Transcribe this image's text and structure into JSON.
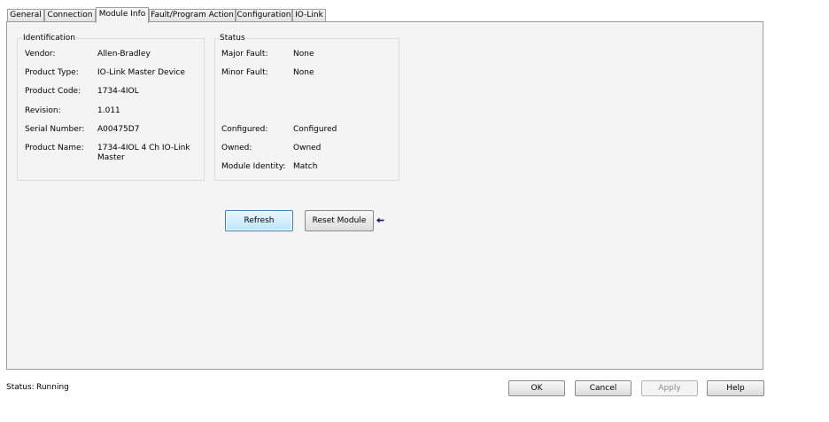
{
  "tabs": {
    "general": "General",
    "connection": "Connection",
    "module_info": "Module Info",
    "fault_program_action": "Fault/Program Action",
    "configuration": "Configuration",
    "io_link": "IO-Link"
  },
  "identification": {
    "title": "Identification",
    "vendor_label": "Vendor:",
    "vendor": "Allen-Bradley",
    "product_type_label": "Product Type:",
    "product_type": "IO-Link Master Device",
    "product_code_label": "Product Code:",
    "product_code": "1734-4IOL",
    "revision_label": "Revision:",
    "revision": "1.011",
    "serial_number_label": "Serial Number:",
    "serial_number": "A00475D7",
    "product_name_label": "Product Name:",
    "product_name_line1": "1734-4IOL 4 Ch IO-Link",
    "product_name_line2": "Master"
  },
  "status_group": {
    "title": "Status",
    "major_fault_label": "Major Fault:",
    "major_fault": "None",
    "minor_fault_label": "Minor Fault:",
    "minor_fault": "None",
    "configured_label": "Configured:",
    "configured": "Configured",
    "owned_label": "Owned:",
    "owned": "Owned",
    "module_identity_label": "Module Identity:",
    "module_identity": "Match"
  },
  "actions": {
    "refresh": "Refresh",
    "reset_module": "Reset Module"
  },
  "footer": {
    "status_label": "Status:",
    "status_value": "Running",
    "ok": "OK",
    "cancel": "Cancel",
    "apply": "Apply",
    "help": "Help"
  },
  "icons": {
    "reset_arrow": "arrow-left-icon"
  },
  "colors": {
    "panel_bg": "#f4f4f4",
    "focus_border": "#3c7fb1",
    "arrow": "#1a1a6e"
  }
}
